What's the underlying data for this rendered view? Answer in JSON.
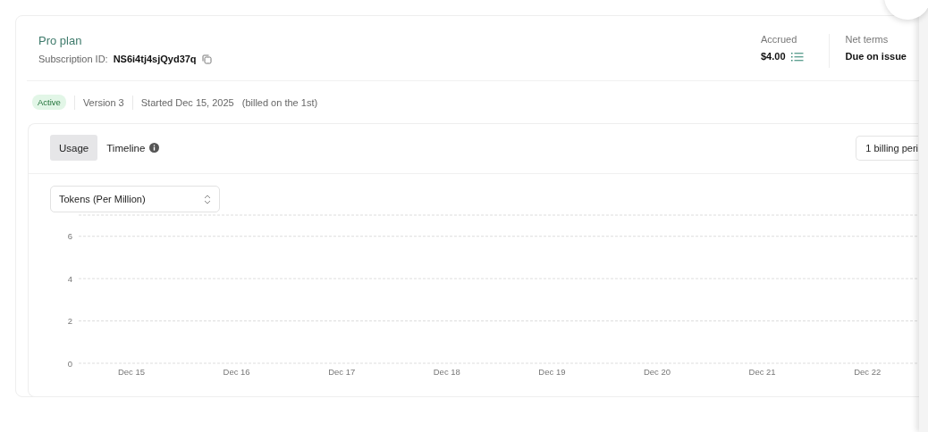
{
  "plan": {
    "title": "Pro plan",
    "subscription_label": "Subscription ID:",
    "subscription_id": "NS6i4tj4sjQyd37q"
  },
  "summary": [
    {
      "label": "Accrued",
      "value": "$4.00",
      "kind": "breakdown"
    },
    {
      "label": "Net terms",
      "value": "Due on issue",
      "kind": "plain"
    }
  ],
  "status": {
    "badge": "Active",
    "version": "Version 3",
    "started": "Started Dec 15, 2025",
    "billing_note": "(billed on the 1st)"
  },
  "tabs": [
    {
      "label": "Usage",
      "selected": true,
      "info": false
    },
    {
      "label": "Timeline",
      "selected": false,
      "info": true
    }
  ],
  "period_button": "1 billing peri",
  "metric_select": "Tokens (Per Million)",
  "chart_data": {
    "type": "line",
    "categories": [
      "Dec 15",
      "Dec 16",
      "Dec 17",
      "Dec 18",
      "Dec 19",
      "Dec 20",
      "Dec 21",
      "Dec 22"
    ],
    "ylim": [
      0,
      7
    ],
    "yticks": [
      0,
      2,
      4,
      6
    ],
    "grid": true
  }
}
